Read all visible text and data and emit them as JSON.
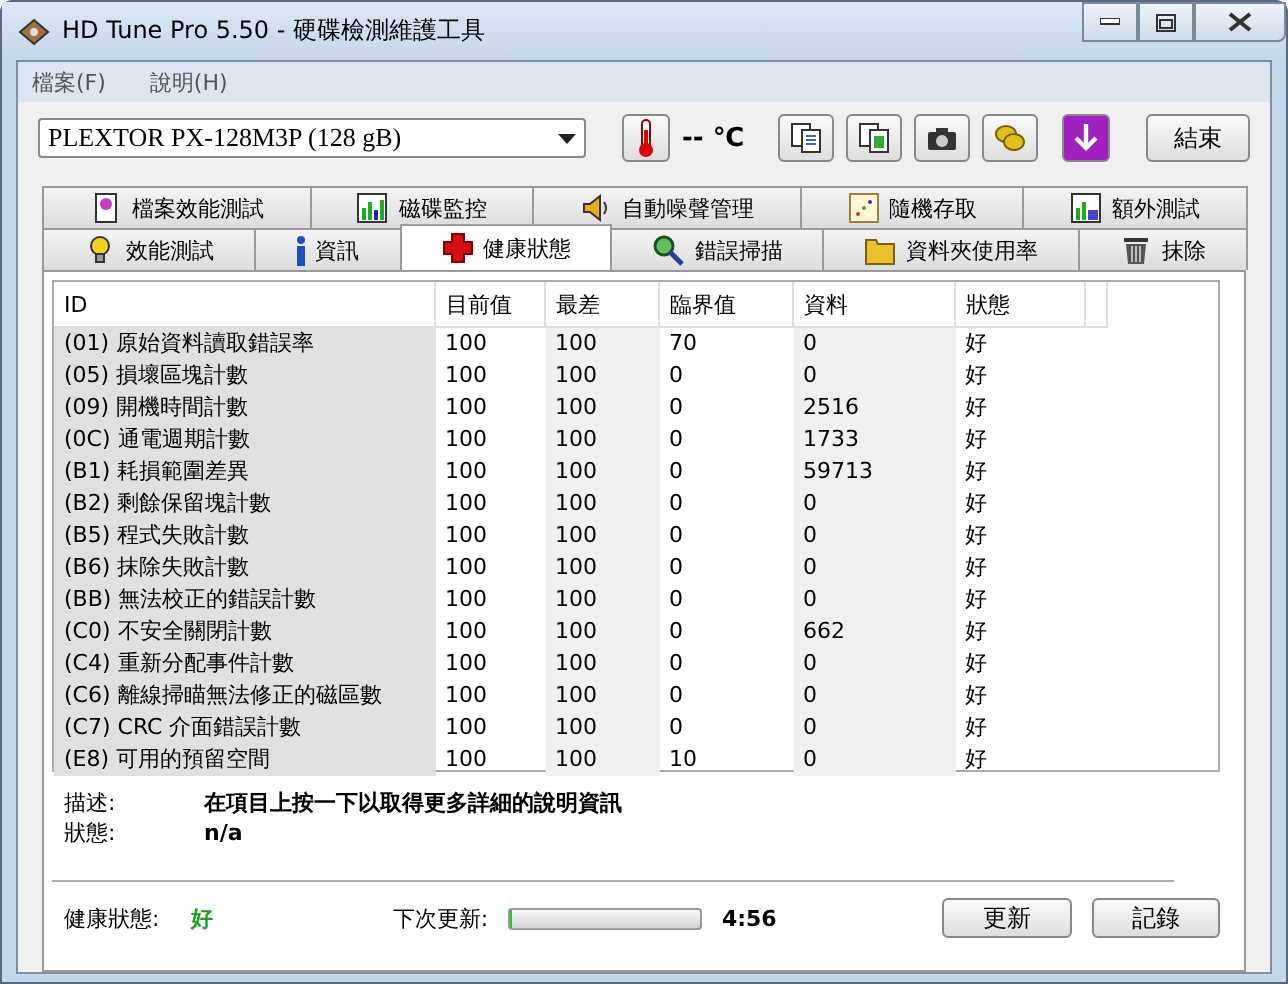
{
  "window": {
    "title": "HD Tune Pro 5.50 - 硬碟檢測維護工具"
  },
  "menu": [
    {
      "label": "檔案(F)"
    },
    {
      "label": "說明(H)"
    }
  ],
  "toolbar": {
    "drive": "PLEXTOR PX-128M3P (128 gB)",
    "temperature": "-- ℃",
    "exit_button": "結束"
  },
  "tab_rows": [
    [
      {
        "label": "檔案效能測試",
        "selected": false
      },
      {
        "label": "磁碟監控",
        "selected": false
      },
      {
        "label": "自動噪聲管理",
        "selected": false
      },
      {
        "label": "隨機存取",
        "selected": false
      },
      {
        "label": "額外測試",
        "selected": false
      }
    ],
    [
      {
        "label": "效能測試",
        "selected": false
      },
      {
        "label": "資訊",
        "selected": false
      },
      {
        "label": "健康狀態",
        "selected": true
      },
      {
        "label": "錯誤掃描",
        "selected": false
      },
      {
        "label": "資料夾使用率",
        "selected": false
      },
      {
        "label": "抹除",
        "selected": false
      }
    ]
  ],
  "table": {
    "columns": [
      "ID",
      "目前值",
      "最差",
      "臨界值",
      "資料",
      "狀態"
    ],
    "rows": [
      [
        "(01) 原始資料讀取錯誤率",
        "100",
        "100",
        "70",
        "0",
        "好"
      ],
      [
        "(05) 損壞區塊計數",
        "100",
        "100",
        "0",
        "0",
        "好"
      ],
      [
        "(09) 開機時間計數",
        "100",
        "100",
        "0",
        "2516",
        "好"
      ],
      [
        "(0C) 通電週期計數",
        "100",
        "100",
        "0",
        "1733",
        "好"
      ],
      [
        "(B1) 耗損範圍差異",
        "100",
        "100",
        "0",
        "59713",
        "好"
      ],
      [
        "(B2) 剩餘保留塊計數",
        "100",
        "100",
        "0",
        "0",
        "好"
      ],
      [
        "(B5) 程式失敗計數",
        "100",
        "100",
        "0",
        "0",
        "好"
      ],
      [
        "(B6) 抹除失敗計數",
        "100",
        "100",
        "0",
        "0",
        "好"
      ],
      [
        "(BB) 無法校正的錯誤計數",
        "100",
        "100",
        "0",
        "0",
        "好"
      ],
      [
        "(C0) 不安全關閉計數",
        "100",
        "100",
        "0",
        "662",
        "好"
      ],
      [
        "(C4) 重新分配事件計數",
        "100",
        "100",
        "0",
        "0",
        "好"
      ],
      [
        "(C6) 離線掃瞄無法修正的磁區數",
        "100",
        "100",
        "0",
        "0",
        "好"
      ],
      [
        "(C7) CRC 介面錯誤計數",
        "100",
        "100",
        "0",
        "0",
        "好"
      ],
      [
        "(E8) 可用的預留空間",
        "100",
        "100",
        "10",
        "0",
        "好"
      ]
    ]
  },
  "details": {
    "description_label": "描述:",
    "description": "在項目上按一下以取得更多詳細的說明資訊",
    "status_label": "狀態:",
    "status": "n/a"
  },
  "footer": {
    "health_label": "健康狀態:",
    "health": "好",
    "next_update_label": "下次更新:",
    "countdown": {
      "level": 0.01
    },
    "time": "4:56",
    "buttons": [
      "更新",
      "記錄"
    ]
  }
}
